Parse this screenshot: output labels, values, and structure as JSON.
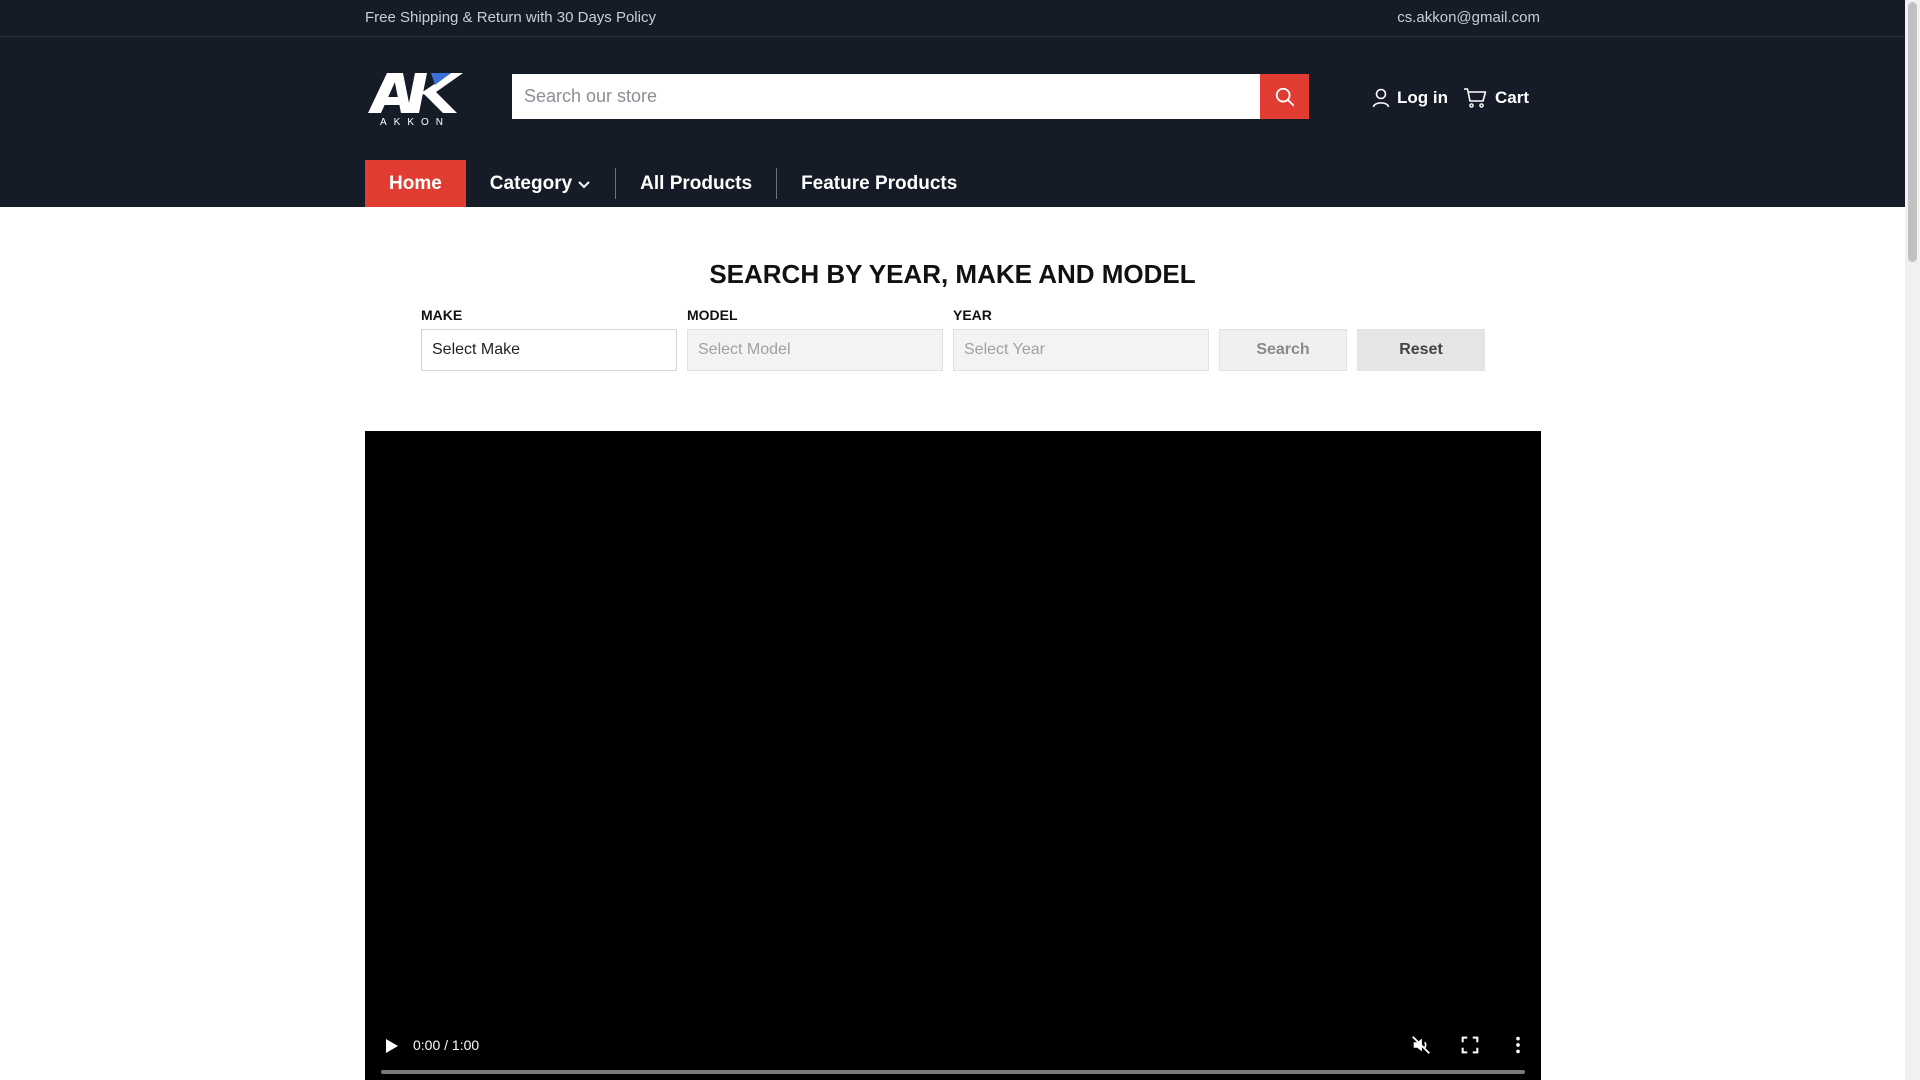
{
  "topbar": {
    "promo": "Free Shipping & Return with 30 Days Policy",
    "email": "cs.akkon@gmail.com"
  },
  "header": {
    "logo_text": "AKKON",
    "search_placeholder": "Search our store",
    "account_label": "Log in",
    "cart_label": "Cart",
    "accent_color": "#e03c31",
    "background_color": "#151c27"
  },
  "nav": {
    "items": [
      {
        "label": "Home",
        "active": true
      },
      {
        "label": "Category",
        "has_dropdown": true
      },
      {
        "label": "All Products"
      },
      {
        "label": "Feature Products"
      }
    ]
  },
  "ymm": {
    "title": "SEARCH BY YEAR, MAKE AND MODEL",
    "make_label": "MAKE",
    "make_value": "Select Make",
    "model_label": "MODEL",
    "model_value": "Select Model",
    "year_label": "YEAR",
    "year_value": "Select Year",
    "search_label": "Search",
    "reset_label": "Reset"
  },
  "video": {
    "time": "0:00 / 1:00",
    "progress": 0
  },
  "icons": {
    "search": "search-icon",
    "account": "user-icon",
    "cart": "cart-icon",
    "dropdown": "chevron-down-icon",
    "play": "play-icon",
    "mute": "volume-muted-icon",
    "fullscreen": "fullscreen-icon",
    "more": "more-vertical-icon"
  }
}
